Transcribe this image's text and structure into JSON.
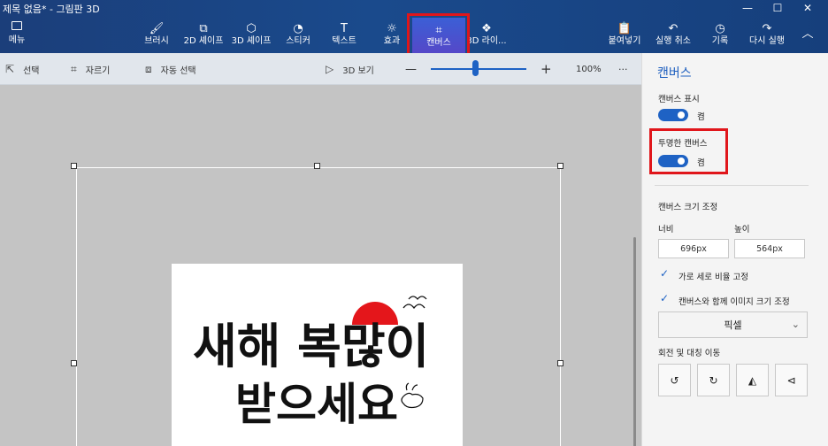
{
  "window": {
    "title": "제목 없음* - 그림판 3D",
    "minimize_glyph": "—",
    "maximize_glyph": "☐",
    "close_glyph": "✕"
  },
  "ribbon": {
    "menu_label": "메뉴",
    "tools": [
      {
        "label": "브러시",
        "icon": "brush-icon",
        "glyph": "🖌"
      },
      {
        "label": "2D 셰이프",
        "icon": "shapes-2d-icon",
        "glyph": "⧉"
      },
      {
        "label": "3D 셰이프",
        "icon": "cube-icon",
        "glyph": "⬡"
      },
      {
        "label": "스티커",
        "icon": "sticker-icon",
        "glyph": "◔"
      },
      {
        "label": "텍스트",
        "icon": "text-icon",
        "glyph": "T"
      },
      {
        "label": "효과",
        "icon": "sun-icon",
        "glyph": "☼"
      },
      {
        "label": "캔버스",
        "icon": "canvas-icon",
        "glyph": "⌗"
      },
      {
        "label": "3D 라이...",
        "icon": "library-3d-icon",
        "glyph": "❖"
      }
    ],
    "right_actions": [
      {
        "label": "붙여넣기",
        "icon": "paste-icon",
        "glyph": "📋"
      },
      {
        "label": "실행 취소",
        "icon": "undo-icon",
        "glyph": "↶"
      },
      {
        "label": "기록",
        "icon": "history-icon",
        "glyph": "◷"
      },
      {
        "label": "다시 실행",
        "icon": "redo-icon",
        "glyph": "↷"
      }
    ],
    "collapse_glyph": "︿",
    "active_tool": "캔버스"
  },
  "toolbar2": {
    "select_label": "선택",
    "crop_label": "자르기",
    "magic_select_label": "자동 선택",
    "view3d_label": "3D 보기",
    "zoom_minus": "—",
    "zoom_plus": "+",
    "zoom_level_text": "100%",
    "more_glyph": "···",
    "zoom_level": 0.47
  },
  "panel": {
    "title": "캔버스",
    "show_canvas_label": "캔버스 표시",
    "show_canvas_state": "켬",
    "transparent_canvas_label": "투명한 캔버스",
    "transparent_canvas_state": "켬",
    "resize_title": "캔버스 크기 조정",
    "width_label": "너비",
    "height_label": "높이",
    "width_value": "696px",
    "height_value": "564px",
    "lock_ratio_label": "가로 세로 비율 고정",
    "resize_image_label": "캔버스와 함께 이미지 크기 조정",
    "unit_value": "픽셀",
    "rotate_title": "회전 및 대칭 이동"
  },
  "artwork": {
    "line1": "새해 복많이",
    "line2": "받으세요"
  },
  "colors": {
    "accent": "#1e62c4",
    "highlight": "#e0161b",
    "ribbon": "#1a4a8c"
  }
}
